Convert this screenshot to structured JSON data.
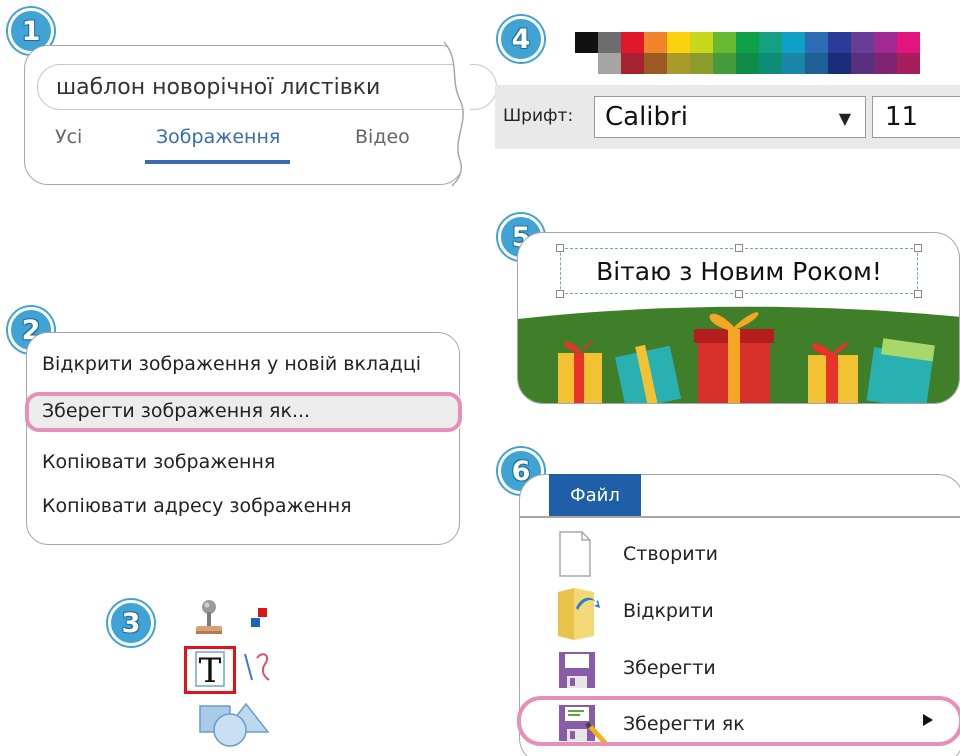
{
  "steps": [
    "1",
    "2",
    "3",
    "4",
    "5",
    "6"
  ],
  "search": {
    "query": "шаблон новорічної листівки",
    "tabs": [
      "Усі",
      "Зображення",
      "Відео"
    ],
    "active_tab": "Зображення"
  },
  "context_menu": {
    "items": [
      "Відкрити зображення у новій вкладці",
      "Зберегти зображення як...",
      "Копіювати зображення",
      "Копіювати адресу зображення"
    ],
    "highlighted": "Зберегти зображення як..."
  },
  "tools": {
    "items": [
      "stamp-icon",
      "color-swap-icon",
      "text-tool-icon",
      "line-curve-icon",
      "shapes-icon"
    ],
    "selected": "text-tool-icon"
  },
  "formatting": {
    "palette_top": [
      "#111111",
      "#6d6d6d",
      "#e2182a",
      "#f0852c",
      "#fcd20f",
      "#c8d81b",
      "#6ab932",
      "#10a04a",
      "#16a083",
      "#0fa0c6",
      "#2e6db4",
      "#2a3c98",
      "#6b3c97",
      "#a02a92",
      "#e3147d"
    ],
    "palette_bottom": [
      "#ffffff",
      "#a5a5a5",
      "#a52330",
      "#9a5a24",
      "#a89a2a",
      "#8b9b2c",
      "#459b3c",
      "#0f8c4a",
      "#0f8c78",
      "#1b87a8",
      "#1f5f95",
      "#1c2c7b",
      "#57307e",
      "#7f2472",
      "#a61e5c"
    ],
    "font_label": "Шрифт:",
    "font_name": "Calibri",
    "font_size": "11"
  },
  "card": {
    "greeting": "Вітаю з Новим Роком!"
  },
  "file_menu": {
    "tab": "Файл",
    "items": [
      "Створити",
      "Відкрити",
      "Зберегти",
      "Зберегти як"
    ],
    "highlighted": "Зберегти як"
  }
}
